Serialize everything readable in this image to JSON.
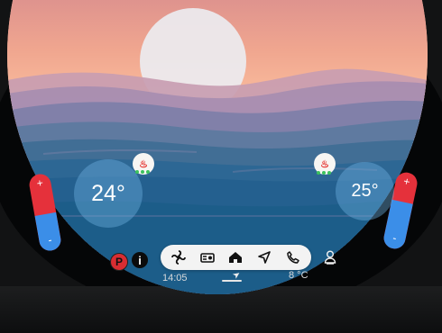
{
  "climate": {
    "left_temp": "24°",
    "right_temp": "25°",
    "plus": "+",
    "minus": "-",
    "heat_label": "♨"
  },
  "status": {
    "time": "14:05",
    "outside_temp": "8 °C",
    "park_label": "P",
    "info_label": "i"
  },
  "dock": {
    "items": [
      "fan",
      "radio",
      "home",
      "navigation",
      "phone"
    ]
  },
  "colors": {
    "slider_red": "#e5313b",
    "slider_blue": "#3b8ee8",
    "temp_bubble": "#6eb1e0"
  }
}
